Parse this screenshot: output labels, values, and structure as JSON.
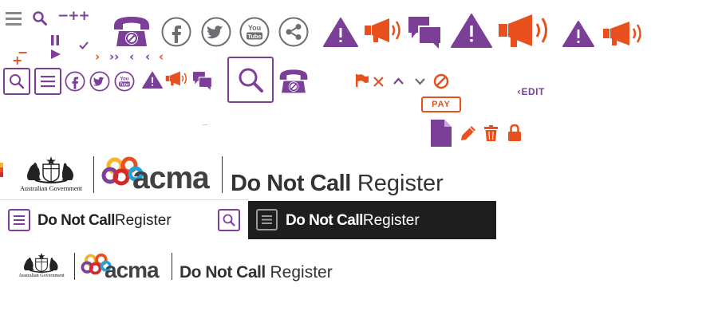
{
  "colors": {
    "purple": "#7b3f98",
    "orange": "#e8501e",
    "grey": "#888888",
    "icon_grey": "#6d6e71",
    "dark_bar": "#1e1e1e",
    "text_dark": "#333333"
  },
  "sprites": {
    "minus_plus_plus": "−++",
    "minus": "−",
    "plus": "+",
    "chevrons": [
      "›",
      "››",
      "‹",
      "‹",
      "‹"
    ],
    "pay_label": "PAY",
    "edit_label": "EDIT"
  },
  "icons": {
    "youtube_you": "You",
    "youtube_tube": "Tube"
  },
  "logos": {
    "gov_caption": "Australian Government",
    "acma": "acma",
    "dnc_bold": "Do Not Call",
    "dnc_regular": "Register"
  }
}
